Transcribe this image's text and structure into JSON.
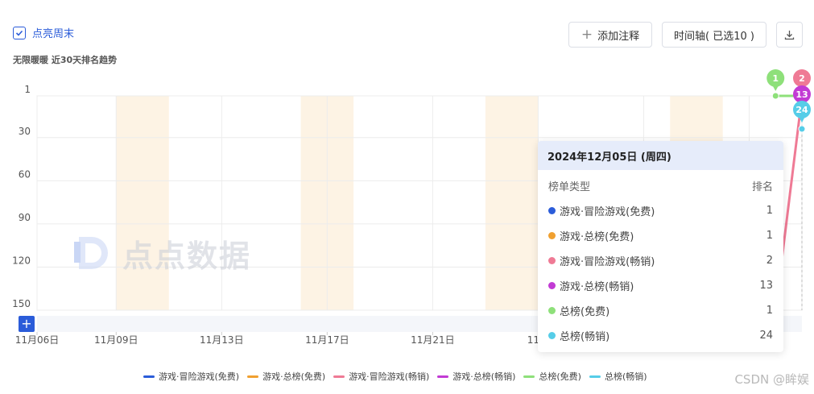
{
  "weekend_toggle": {
    "label": "点亮周末",
    "checked": true
  },
  "subtitle": "无限暖暖 近30天排名趋势",
  "toolbar": {
    "add_note": "添加注释",
    "timeline": "时间轴( 已选10 )"
  },
  "watermark": "点点数据",
  "tooltip": {
    "date": "2024年12月05日 (周四)",
    "col_type": "榜单类型",
    "col_rank": "排名",
    "rows": [
      {
        "name": "游戏·冒险游戏(免费)",
        "rank": "1",
        "color": "#2b5cd9"
      },
      {
        "name": "游戏·总榜(免费)",
        "rank": "1",
        "color": "#f0a030"
      },
      {
        "name": "游戏·冒险游戏(畅销)",
        "rank": "2",
        "color": "#ef7a95"
      },
      {
        "name": "游戏·总榜(畅销)",
        "rank": "13",
        "color": "#c23bd4"
      },
      {
        "name": "总榜(免费)",
        "rank": "1",
        "color": "#8ee07a"
      },
      {
        "name": "总榜(畅销)",
        "rank": "24",
        "color": "#56cde8"
      }
    ]
  },
  "credit": "CSDN @眸娱",
  "chart_data": {
    "type": "line",
    "title": "无限暖暖 近30天排名趋势",
    "xlabel": "",
    "ylabel": "",
    "y_inverted": true,
    "ylim": [
      1,
      150
    ],
    "yticks": [
      "1",
      "30",
      "60",
      "90",
      "120",
      "150"
    ],
    "x_tick_labels": [
      "11月06日",
      "11月09日",
      "11月13日",
      "11月17日",
      "11月21日",
      "11月"
    ],
    "highlight_weekends": true,
    "grid": true,
    "legend_position": "bottom",
    "series": [
      {
        "name": "游戏·冒险游戏(免费)",
        "color": "#2b5cd9",
        "points": []
      },
      {
        "name": "游戏·总榜(免费)",
        "color": "#f0a030",
        "points": []
      },
      {
        "name": "游戏·冒险游戏(畅销)",
        "color": "#ef7a95",
        "points": [
          [
            "2024-12-04",
            150
          ],
          [
            "2024-12-05",
            2
          ]
        ]
      },
      {
        "name": "游戏·总榜(畅销)",
        "color": "#c23bd4",
        "points": [
          [
            "2024-12-05",
            13
          ]
        ]
      },
      {
        "name": "总榜(免费)",
        "color": "#8ee07a",
        "points": [
          [
            "2024-12-04",
            1
          ],
          [
            "2024-12-05",
            1
          ]
        ]
      },
      {
        "name": "总榜(畅销)",
        "color": "#56cde8",
        "points": [
          [
            "2024-12-05",
            24
          ]
        ]
      }
    ],
    "end_labels": [
      {
        "series": "总榜(免费)",
        "label": "1"
      },
      {
        "series": "游戏·冒险游戏(畅销)",
        "label": "2"
      },
      {
        "series": "游戏·总榜(畅销)",
        "label": "13"
      },
      {
        "series": "总榜(畅销)",
        "label": "24"
      }
    ]
  }
}
